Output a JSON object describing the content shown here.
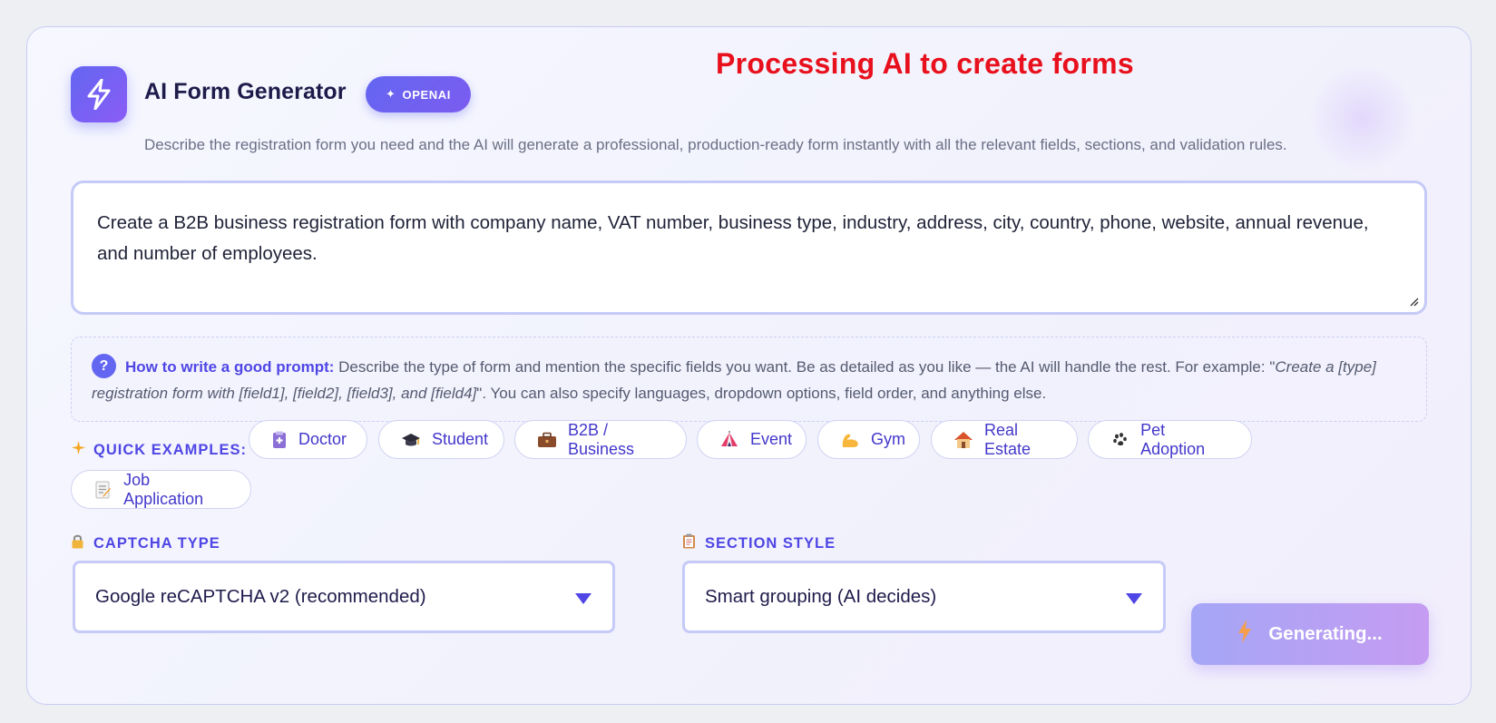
{
  "header": {
    "app_title": "AI Form Generator",
    "badge": "OPENAI",
    "overlay_title": "Processing AI to create forms",
    "subtitle": "Describe the registration form you need and the AI will generate a professional, production-ready form instantly with all the relevant fields, sections, and validation rules.",
    "icons": {
      "logo": "lightning-bolt-icon",
      "badge": "sparkle-icon"
    }
  },
  "prompt": {
    "value": "Create a B2B business registration form with company name, VAT number, business type, industry, address, city, country, phone, website, annual revenue, and number of employees."
  },
  "help": {
    "icon": "?",
    "title": "How to write a good prompt:",
    "text_before": " Describe the type of form and mention the specific fields you want. Be as detailed as you like — the AI will handle the rest. For example: \"",
    "example": "Create a [type] registration form with [field1], [field2], [field3], and [field4]",
    "text_after": "\". You can also specify languages, dropdown options, field order, and anything else."
  },
  "examples": {
    "label": "QUICK EXAMPLES:",
    "chips": [
      {
        "label": "Doctor",
        "icon": "clipboard-medical-icon"
      },
      {
        "label": "Student",
        "icon": "graduation-cap-icon"
      },
      {
        "label": "B2B / Business",
        "icon": "briefcase-icon"
      },
      {
        "label": "Event",
        "icon": "circus-tent-icon"
      },
      {
        "label": "Gym",
        "icon": "flexed-biceps-icon"
      },
      {
        "label": "Real Estate",
        "icon": "house-icon"
      },
      {
        "label": "Pet Adoption",
        "icon": "paw-prints-icon"
      },
      {
        "label": "Job Application",
        "icon": "memo-icon"
      }
    ]
  },
  "captcha": {
    "label": "CAPTCHA TYPE",
    "icon": "lock-icon",
    "selected": "Google reCAPTCHA v2 (recommended)"
  },
  "section_style": {
    "label": "SECTION STYLE",
    "icon": "clipboard-icon",
    "selected": "Smart grouping (AI decides)"
  },
  "generate": {
    "label": "Generating...",
    "icon": "lightning-icon"
  },
  "colors": {
    "accent": "#6366f1",
    "accent_text": "#4f46e5",
    "overlay_red": "#e8101c"
  }
}
